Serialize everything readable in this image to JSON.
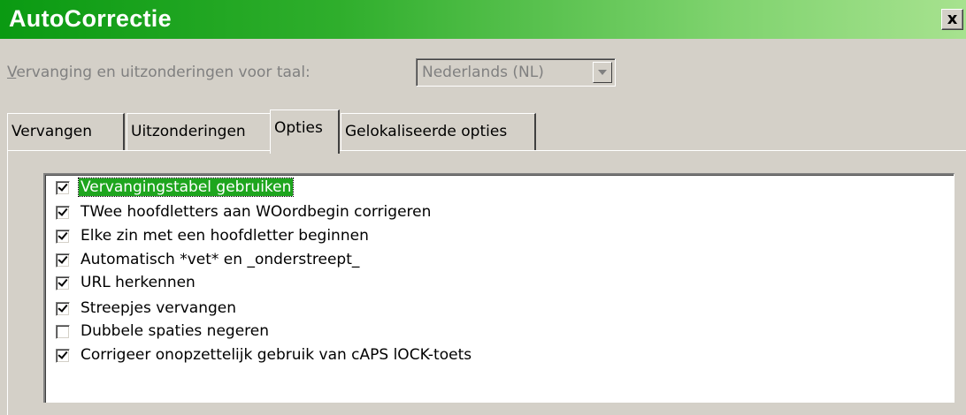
{
  "window": {
    "title": "AutoCorrectie",
    "close_label": "x"
  },
  "language": {
    "label_underlined": "V",
    "label_rest": "ervanging en uitzonderingen voor taal:",
    "value": "Nederlands (NL)"
  },
  "tabs": [
    {
      "label": "Vervangen",
      "active": false
    },
    {
      "label": "Uitzonderingen",
      "active": false
    },
    {
      "label": "Opties",
      "active": true
    },
    {
      "label": "Gelokaliseerde opties",
      "active": false
    }
  ],
  "options": [
    {
      "label": "Vervangingstabel gebruiken",
      "checked": true,
      "selected": true
    },
    {
      "label": "TWee hoofdletters aan WOordbegin corrigeren",
      "checked": true,
      "selected": false
    },
    {
      "label": "Elke zin met een hoofdletter beginnen",
      "checked": true,
      "selected": false
    },
    {
      "label": "Automatisch *vet* en _onderstreept_",
      "checked": true,
      "selected": false
    },
    {
      "label": "URL herkennen",
      "checked": true,
      "selected": false
    },
    {
      "label": "Streepjes vervangen",
      "checked": true,
      "selected": false
    },
    {
      "label": "Dubbele spaties negeren",
      "checked": false,
      "selected": false
    },
    {
      "label": "Corrigeer onopzettelijk gebruik van cAPS lOCK-toets",
      "checked": true,
      "selected": false
    }
  ],
  "colors": {
    "title_gradient_start": "#0a9a12",
    "title_gradient_end": "#a7e28f",
    "selection": "#1ea51e",
    "dialog_face": "#d4d0c8"
  }
}
